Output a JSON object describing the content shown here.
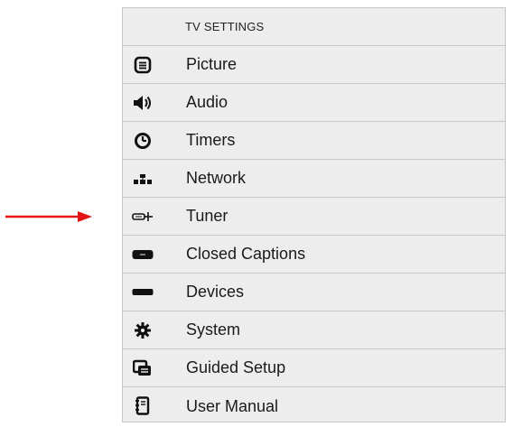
{
  "menu": {
    "title": "TV SETTINGS",
    "items": [
      {
        "label": "Picture",
        "icon": "picture-icon"
      },
      {
        "label": "Audio",
        "icon": "speaker-icon"
      },
      {
        "label": "Timers",
        "icon": "clock-icon"
      },
      {
        "label": "Network",
        "icon": "network-icon"
      },
      {
        "label": "Tuner",
        "icon": "antenna-icon"
      },
      {
        "label": "Closed Captions",
        "icon": "cc-icon"
      },
      {
        "label": "Devices",
        "icon": "devices-icon"
      },
      {
        "label": "System",
        "icon": "gear-icon"
      },
      {
        "label": "Guided Setup",
        "icon": "guided-setup-icon"
      },
      {
        "label": "User Manual",
        "icon": "manual-icon"
      }
    ]
  },
  "colors": {
    "menu_background": "#ededed",
    "border": "#c7c7c7",
    "arrow": "#e31414"
  },
  "annotation": {
    "arrow_points_to": "Tuner"
  }
}
